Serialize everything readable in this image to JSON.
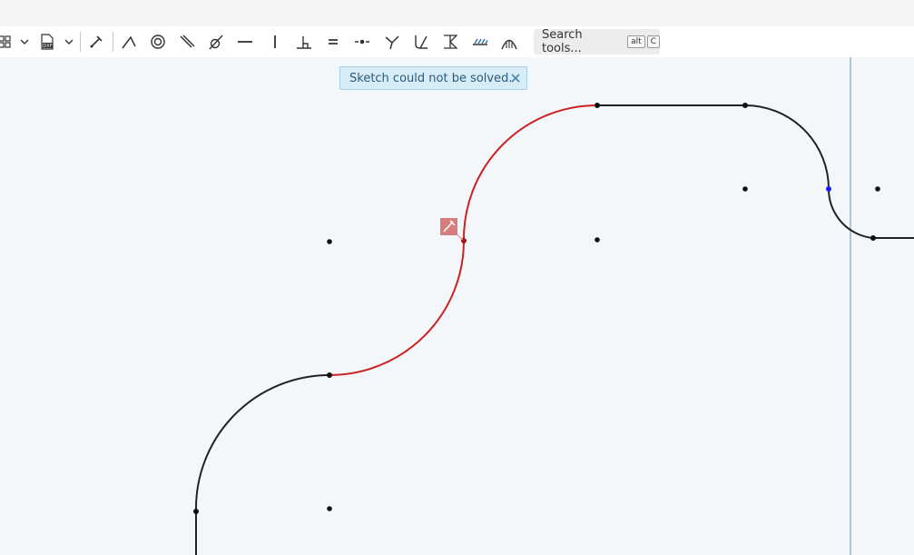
{
  "toolbar": {
    "tools": [
      {
        "name": "sketch-grid-tool-icon"
      },
      {
        "name": "chevron-down-icon"
      },
      {
        "name": "import-dxf-icon",
        "label": "DXF"
      },
      {
        "name": "chevron-down-icon"
      },
      {
        "name": "construction-tool-icon"
      },
      {
        "name": "coincident-constraint-icon"
      },
      {
        "name": "concentric-constraint-icon"
      },
      {
        "name": "parallel-constraint-icon"
      },
      {
        "name": "tangent-constraint-icon"
      },
      {
        "name": "horizontal-constraint-icon"
      },
      {
        "name": "vertical-constraint-icon"
      },
      {
        "name": "perpendicular-constraint-icon"
      },
      {
        "name": "equal-constraint-icon"
      },
      {
        "name": "midpoint-constraint-icon"
      },
      {
        "name": "normal-constraint-icon"
      },
      {
        "name": "pierce-constraint-icon"
      },
      {
        "name": "symmetric-constraint-icon"
      },
      {
        "name": "fix-constraint-icon"
      },
      {
        "name": "curvature-constraint-icon"
      }
    ],
    "search": {
      "label": "Search tools...",
      "shortcut_mod": "alt",
      "shortcut_key": "C"
    }
  },
  "notification": {
    "message": "Sketch could not be solved.",
    "close_icon": "close-icon"
  },
  "sketch": {
    "conflict_marker_icon": "constraint-error-icon",
    "colors": {
      "normal_curve": "#222222",
      "conflict_curve": "#cc2222",
      "selected_point": "#1a1aff",
      "marker": "#d77d7d",
      "reference_line": "#9ab4d0"
    }
  }
}
